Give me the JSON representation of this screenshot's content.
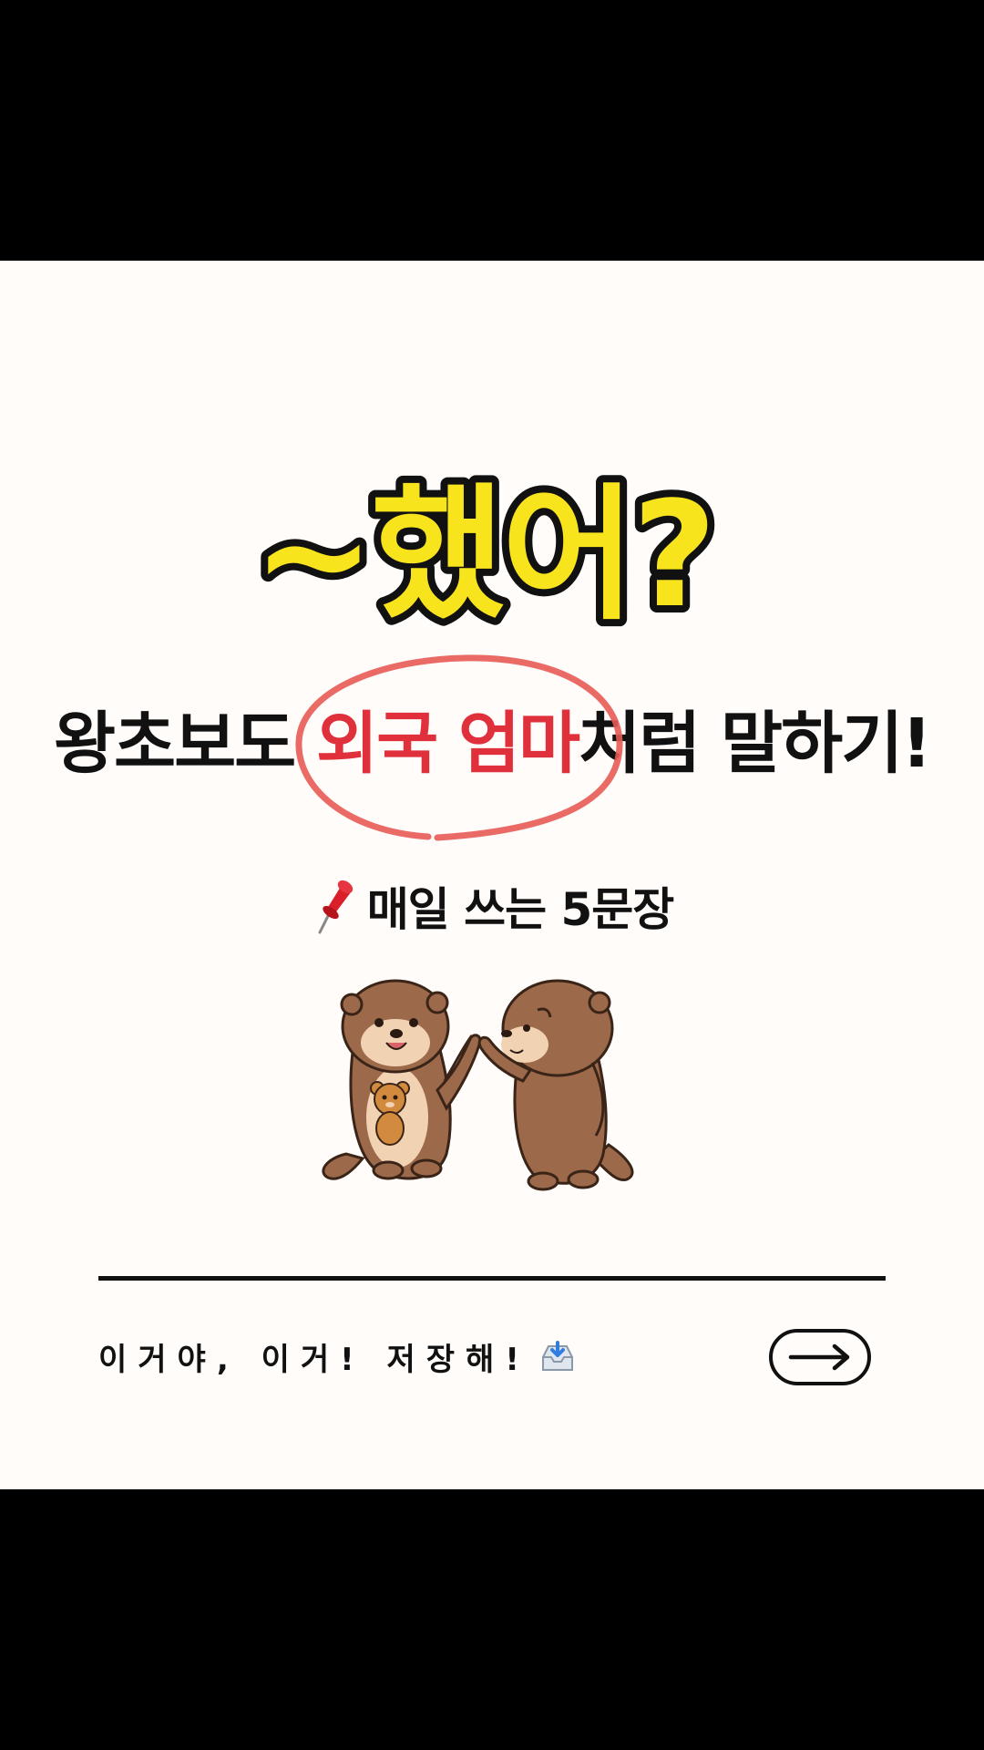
{
  "headline": {
    "text": "~했어?",
    "fill": "#f7e41d",
    "stroke": "#111111"
  },
  "subtitle": {
    "before": "왕초보도 ",
    "highlight": "외국 엄마",
    "after": "처럼 말하기!",
    "highlight_color": "#e0303c",
    "circle_color": "#e85a55"
  },
  "pin_line": {
    "icon": "pushpin-icon",
    "text": "매일 쓰는 5문장"
  },
  "illustration": {
    "name": "two-otters-waving"
  },
  "footer": {
    "text": "이거야, 이거! 저장해!",
    "icon": "inbox-tray-icon",
    "button_icon": "arrow-right-icon"
  }
}
